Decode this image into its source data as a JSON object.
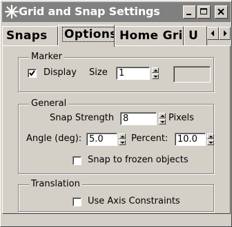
{
  "window": {
    "title": "Grid and Snap Settings",
    "app_icon": "asterisk-icon",
    "buttons": {
      "minimize": "minimize-icon",
      "maximize": "maximize-icon",
      "close": "close-icon"
    }
  },
  "tabs": [
    {
      "label": "Snaps",
      "selected": false
    },
    {
      "label": "Options",
      "selected": true
    },
    {
      "label": "Home Grid",
      "selected": false
    },
    {
      "label": "U",
      "selected": false
    }
  ],
  "tab_scroll": {
    "left": "scroll-left-icon",
    "right": "scroll-right-icon"
  },
  "marker": {
    "title": "Marker",
    "display_label": "Display",
    "display_checked": true,
    "size_label": "Size",
    "size_value": "1",
    "swatch_color": "#d4d0c8"
  },
  "general": {
    "title": "General",
    "snap_strength_label": "Snap Strength",
    "snap_strength_value": "8",
    "snap_strength_unit": "Pixels",
    "angle_label": "Angle (deg):",
    "angle_value": "5.0",
    "percent_label": "Percent:",
    "percent_value": "10.0",
    "snap_frozen_label": "Snap to frozen objects",
    "snap_frozen_checked": false
  },
  "translation": {
    "title": "Translation",
    "axis_constraints_label": "Use Axis Constraints",
    "axis_constraints_checked": false
  },
  "colors": {
    "face": "#d4d0c8",
    "titlebar_inactive": "#808080",
    "shadow": "#808080",
    "dark_shadow": "#404040",
    "highlight": "#ffffff"
  }
}
